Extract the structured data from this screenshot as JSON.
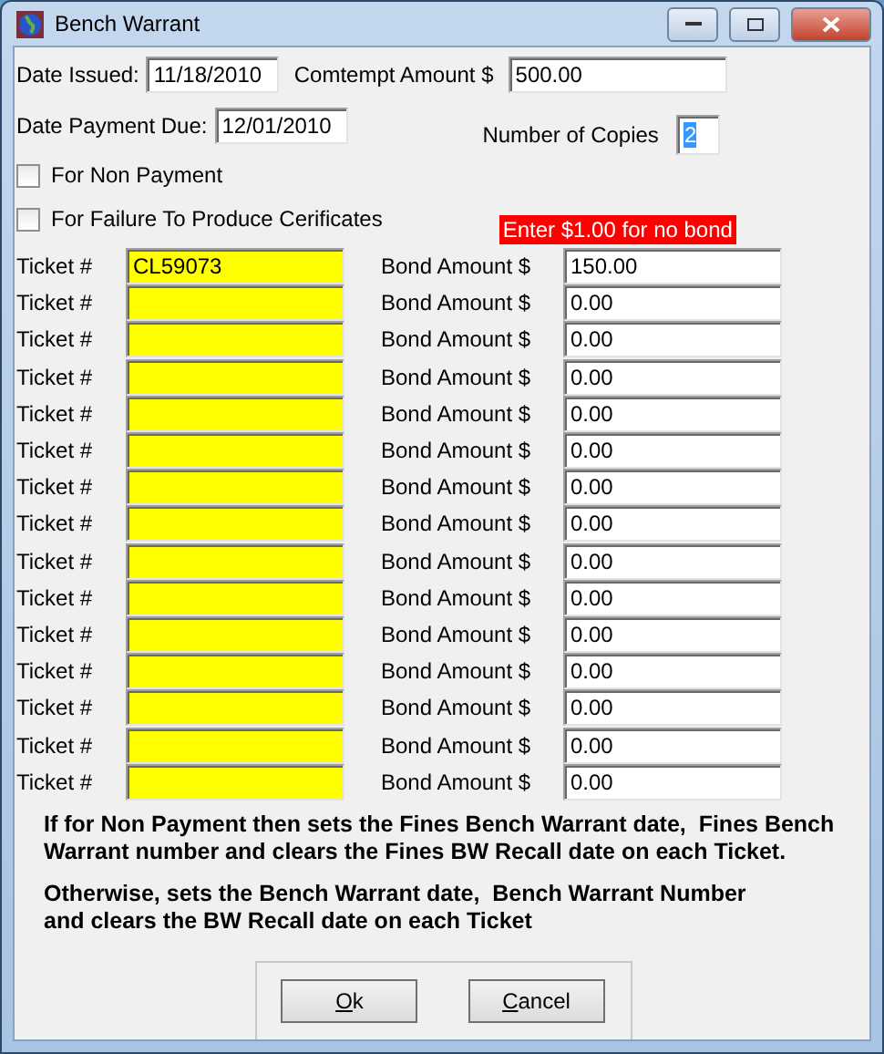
{
  "window": {
    "title": "Bench Warrant"
  },
  "date_issued": {
    "label": "Date Issued:",
    "value": "11/18/2010"
  },
  "contempt_amount": {
    "label": "Comtempt Amount $",
    "value": "500.00"
  },
  "date_payment_due": {
    "label": "Date Payment Due:",
    "value": "12/01/2010"
  },
  "copies": {
    "label": "Number of Copies",
    "value": "2",
    "highlighted": true
  },
  "checkboxes": [
    {
      "label": "For Non Payment",
      "checked": false
    },
    {
      "label": "For Failure To Produce Cerificates",
      "checked": false
    }
  ],
  "bond_note": "Enter $1.00 for no bond",
  "tickets": [
    {
      "ticket_label": "Ticket #",
      "ticket": "CL59073",
      "bond_label": "Bond Amount $",
      "bond": "150.00"
    },
    {
      "ticket_label": "Ticket #",
      "bond_label": "Bond Amount $",
      "bond": "0.00"
    },
    {
      "ticket_label": "Ticket #",
      "bond_label": "Bond Amount $",
      "bond": "0.00"
    },
    {
      "ticket_label": "Ticket #",
      "bond_label": "Bond Amount $",
      "bond": "0.00"
    },
    {
      "ticket_label": "Ticket #",
      "bond_label": "Bond Amount $",
      "bond": "0.00"
    },
    {
      "ticket_label": "Ticket #",
      "bond_label": "Bond Amount $",
      "bond": "0.00"
    },
    {
      "ticket_label": "Ticket #",
      "bond_label": "Bond Amount $",
      "bond": "0.00"
    },
    {
      "ticket_label": "Ticket #",
      "bond_label": "Bond Amount $",
      "bond": "0.00"
    },
    {
      "ticket_label": "Ticket #",
      "bond_label": "Bond Amount $",
      "bond": "0.00"
    },
    {
      "ticket_label": "Ticket #",
      "bond_label": "Bond Amount $",
      "bond": "0.00"
    },
    {
      "ticket_label": "Ticket #",
      "bond_label": "Bond Amount $",
      "bond": "0.00"
    },
    {
      "ticket_label": "Ticket #",
      "bond_label": "Bond Amount $",
      "bond": "0.00"
    },
    {
      "ticket_label": "Ticket #",
      "bond_label": "Bond Amount $",
      "bond": "0.00"
    },
    {
      "ticket_label": "Ticket #",
      "bond_label": "Bond Amount $",
      "bond": "0.00"
    },
    {
      "ticket_label": "Ticket #",
      "bond_label": "Bond Amount $",
      "bond": "0.00"
    }
  ],
  "notes": [
    "If for Non Payment then sets the Fines Bench Warrant date,  Fines Bench\nWarrant number and clears the Fines BW Recall date on each Ticket.",
    "Otherwise, sets the Bench Warrant date,  Bench Warrant Number\nand clears the BW Recall date on each Ticket"
  ],
  "buttons": [
    "Ok",
    "Cancel"
  ]
}
